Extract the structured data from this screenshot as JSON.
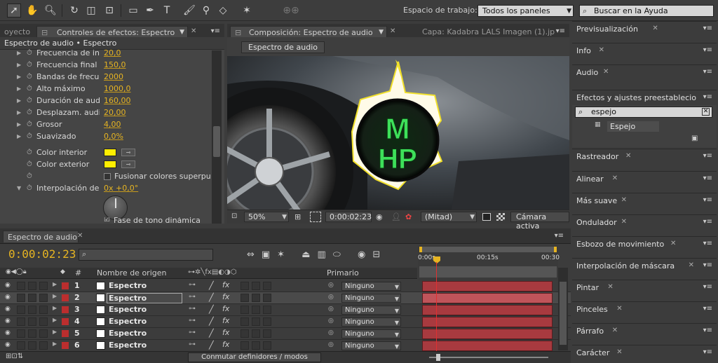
{
  "toolbar": {
    "tools": [
      "selection-tool",
      "hand-tool",
      "zoom-tool",
      "rotate-tool",
      "camera-tool",
      "pan-behind-tool",
      "rectangle-tool",
      "pen-tool",
      "text-tool",
      "brush-tool",
      "clone-stamp-tool",
      "eraser-tool",
      "puppet-pin-tool"
    ],
    "workspace_label": "Espacio de trabajo:",
    "workspace_value": "Todos los paneles",
    "search_placeholder": "Buscar en la Ayuda"
  },
  "left_tabs": {
    "project_tab": "oyecto",
    "effects_tab": "Controles de efectos: Espectro"
  },
  "effect_controls": {
    "title": "Espectro de audio • Espectro",
    "rows": [
      {
        "label": "Frecuencia de inic",
        "value": "20,0"
      },
      {
        "label": "Frecuencia final",
        "value": "150,0"
      },
      {
        "label": "Bandas de frecue",
        "value": "2000"
      },
      {
        "label": "Alto máximo",
        "value": "1000,0"
      },
      {
        "label": "Duración de audi",
        "value": "160,00"
      },
      {
        "label": "Desplazam. audio",
        "value": "20,00"
      },
      {
        "label": "Grosor",
        "value": "4,00"
      },
      {
        "label": "Suavizado",
        "value": "0,0%"
      }
    ],
    "color_interior_label": "Color interior",
    "color_exterior_label": "Color exterior",
    "color_value": "#ffee00",
    "blend_label": "Fusionar colores superpu",
    "interp_label": "Interpolación de",
    "interp_value": "0x +0,0°",
    "last_label": "Fase de tono dinámica"
  },
  "comp": {
    "tab": "Composición: Espectro de audio",
    "layer_tab": "Capa: Kadabra LALS Imagen (1).jp",
    "breadcrumb": "Espectro de audio",
    "logo_top": "M",
    "logo_bottom": "HP",
    "zoom": "50%",
    "time": "0:00:02:23",
    "resolution": "(Mitad)",
    "camera": "Cámara activa"
  },
  "right_panels": [
    "Previsualización",
    "Info",
    "Audio",
    "Efectos y ajustes preestablecio",
    "Rastreador",
    "Alinear",
    "Más suave",
    "Ondulador",
    "Esbozo de movimiento",
    "Interpolación de máscara",
    "Pintar",
    "Pinceles",
    "Párrafo",
    "Carácter"
  ],
  "effects_search": {
    "value": "espejo",
    "result": "Espejo"
  },
  "timeline": {
    "tab": "Espectro de audio",
    "time": "0:00:02:23",
    "col_hash": "#",
    "col_name": "Nombre de origen",
    "col_parent": "Primario",
    "ruler": [
      "0:00s",
      "00:15s",
      "00:30"
    ],
    "switch_label": "Conmutar definidores / modos",
    "layers": [
      {
        "num": "1",
        "name": "Espectro",
        "parent": "Ninguno"
      },
      {
        "num": "2",
        "name": "Espectro",
        "parent": "Ninguno"
      },
      {
        "num": "3",
        "name": "Espectro",
        "parent": "Ninguno"
      },
      {
        "num": "4",
        "name": "Espectro",
        "parent": "Ninguno"
      },
      {
        "num": "5",
        "name": "Espectro",
        "parent": "Ninguno"
      },
      {
        "num": "6",
        "name": "Espectro",
        "parent": "Ninguno"
      }
    ]
  }
}
